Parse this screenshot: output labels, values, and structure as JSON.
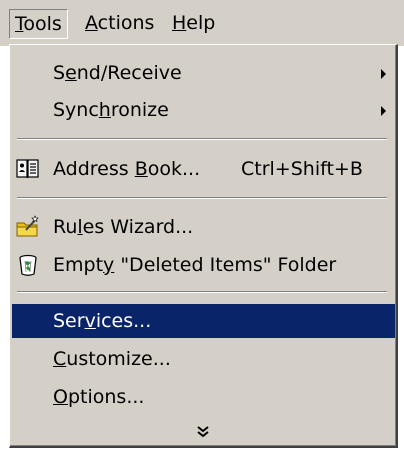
{
  "menubar": {
    "tools": {
      "pre": "",
      "key": "T",
      "post": "ools"
    },
    "actions": {
      "pre": "",
      "key": "A",
      "post": "ctions"
    },
    "help": {
      "pre": "",
      "key": "H",
      "post": "elp"
    }
  },
  "menu": {
    "send_receive": {
      "pre": "S",
      "key": "e",
      "post": "nd/Receive"
    },
    "synchronize": {
      "pre": "Sync",
      "key": "h",
      "post": "ronize"
    },
    "address_book": {
      "pre": "Address ",
      "key": "B",
      "post": "ook...",
      "shortcut": "Ctrl+Shift+B"
    },
    "rules_wizard": {
      "pre": "Ru",
      "key": "l",
      "post": "es Wizard..."
    },
    "empty_deleted": {
      "pre": "Empt",
      "key": "y",
      "post": " \"Deleted Items\" Folder"
    },
    "services": {
      "pre": "Ser",
      "key": "v",
      "post": "ices..."
    },
    "customize": {
      "pre": "",
      "key": "C",
      "post": "ustomize..."
    },
    "options": {
      "pre": "",
      "key": "O",
      "post": "ptions..."
    }
  },
  "icons": {
    "address_book": "address-book-icon",
    "rules_wizard": "rules-wizard-icon",
    "empty_deleted": "trash-can-icon",
    "expand": "double-chevron-down-icon"
  },
  "colors": {
    "menu_face": "#d4d0c8",
    "highlight": "#0a246a",
    "highlight_text": "#ffffff"
  }
}
